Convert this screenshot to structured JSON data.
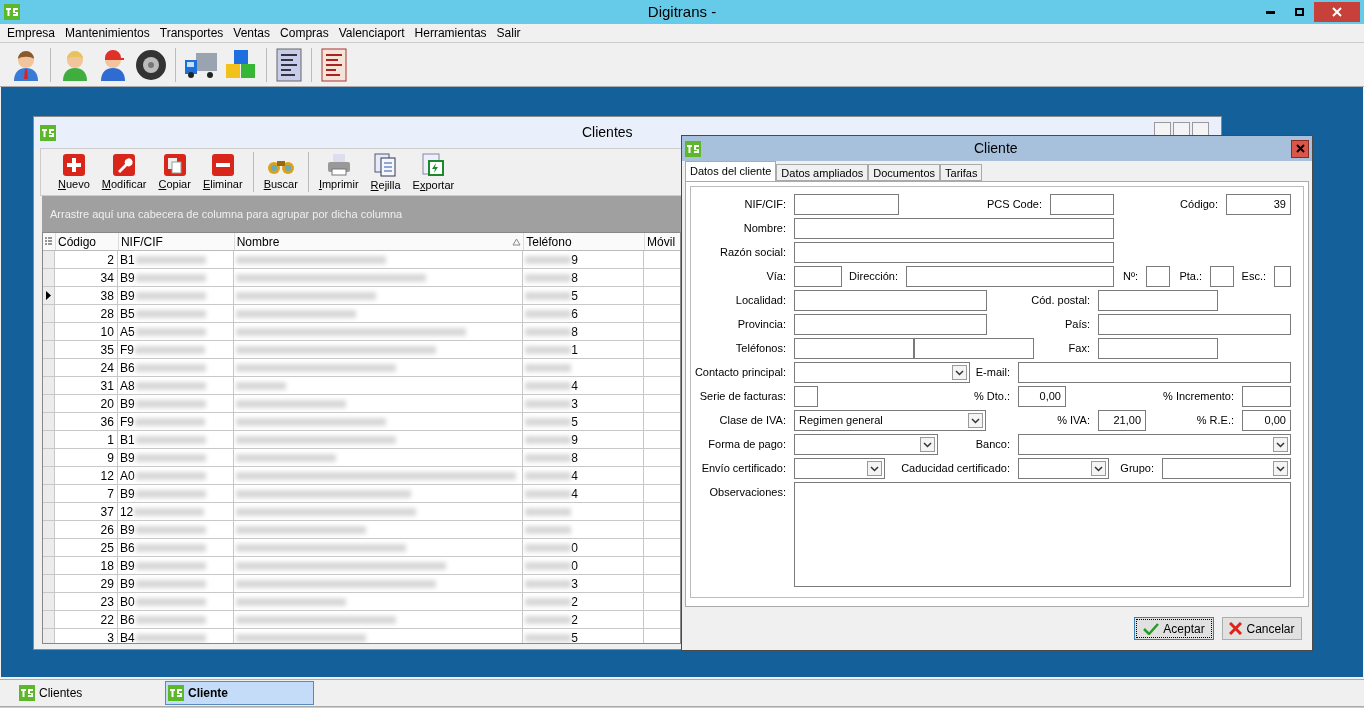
{
  "window": {
    "title": "Digitrans -"
  },
  "menu": [
    "Empresa",
    "Mantenimientos",
    "Transportes",
    "Ventas",
    "Compras",
    "Valenciaport",
    "Herramientas",
    "Salir"
  ],
  "clientes_window": {
    "title": "Clientes",
    "toolbar": [
      {
        "label": "Nuevo"
      },
      {
        "label": "Modificar"
      },
      {
        "label": "Copiar"
      },
      {
        "label": "Eliminar"
      },
      {
        "label": "Buscar"
      },
      {
        "label": "Imprimir"
      },
      {
        "label": "Rejilla"
      },
      {
        "label": "Exportar"
      }
    ],
    "group_hint": "Arrastre aquí una cabecera de columna para agrupar por dicha columna",
    "columns": [
      {
        "label": "Código",
        "sorted": false
      },
      {
        "label": "NIF/CIF",
        "sorted": false
      },
      {
        "label": "Nombre",
        "sorted": true
      },
      {
        "label": "Teléfono",
        "sorted": false
      },
      {
        "label": "Móvil",
        "sorted": false
      }
    ],
    "rows": [
      {
        "codigo": "2",
        "nif": "B1",
        "telefono": "9",
        "selected": false
      },
      {
        "codigo": "34",
        "nif": "B9",
        "telefono": "8",
        "selected": false
      },
      {
        "codigo": "38",
        "nif": "B9",
        "telefono": "5",
        "selected": true
      },
      {
        "codigo": "28",
        "nif": "B5",
        "telefono": "6",
        "selected": false
      },
      {
        "codigo": "10",
        "nif": "A5",
        "telefono": "8",
        "selected": false
      },
      {
        "codigo": "35",
        "nif": "F9",
        "telefono": "1",
        "selected": false
      },
      {
        "codigo": "24",
        "nif": "B6",
        "selected": false
      },
      {
        "codigo": "31",
        "nif": "A8",
        "telefono": "4",
        "selected": false
      },
      {
        "codigo": "20",
        "nif": "B9",
        "telefono": "3",
        "selected": false
      },
      {
        "codigo": "36",
        "nif": "F9",
        "telefono": "5",
        "selected": false
      },
      {
        "codigo": "1",
        "nif": "B1",
        "telefono": "9",
        "selected": false
      },
      {
        "codigo": "9",
        "nif": "B9",
        "telefono": "8",
        "selected": false
      },
      {
        "codigo": "12",
        "nif": "A0",
        "telefono": "4",
        "selected": false
      },
      {
        "codigo": "7",
        "nif": "B9",
        "telefono": "4",
        "selected": false
      },
      {
        "codigo": "37",
        "nif": "12",
        "selected": false
      },
      {
        "codigo": "26",
        "nif": "B9",
        "selected": false
      },
      {
        "codigo": "25",
        "nif": "B6",
        "telefono": "0",
        "selected": false
      },
      {
        "codigo": "18",
        "nif": "B9",
        "telefono": "0",
        "selected": false
      },
      {
        "codigo": "29",
        "nif": "B9",
        "telefono": "3",
        "selected": false
      },
      {
        "codigo": "23",
        "nif": "B0",
        "telefono": "2",
        "selected": false
      },
      {
        "codigo": "22",
        "nif": "B6",
        "telefono": "2",
        "selected": false
      },
      {
        "codigo": "3",
        "nif": "B4",
        "telefono": "5",
        "selected": false
      }
    ]
  },
  "dialog": {
    "title": "Cliente",
    "tabs": [
      {
        "label": "Datos del cliente",
        "selected": true
      },
      {
        "label": "Datos ampliados",
        "selected": false
      },
      {
        "label": "Documentos",
        "selected": false
      },
      {
        "label": "Tarifas",
        "selected": false
      }
    ],
    "rows": [
      [
        {
          "label": "NIF/CIF:",
          "kind": "text"
        },
        {
          "label": "PCS Code:",
          "kind": "text"
        },
        {
          "label": "Código:",
          "kind": "text",
          "value": "39"
        }
      ],
      [
        {
          "label": "Nombre:",
          "kind": "text"
        }
      ],
      [
        {
          "label": "Razón social:",
          "kind": "text"
        }
      ],
      [
        {
          "label": "Vía:",
          "kind": "text"
        },
        {
          "label": "Dirección:",
          "kind": "text"
        },
        {
          "label": "Nº:",
          "kind": "text"
        },
        {
          "label": "Pta.:",
          "kind": "text"
        },
        {
          "label": "Esc.:",
          "kind": "text"
        }
      ],
      [
        {
          "label": "Localidad:",
          "kind": "text"
        },
        {
          "label": "Cód. postal:",
          "kind": "text"
        }
      ],
      [
        {
          "label": "Provincia:",
          "kind": "text"
        },
        {
          "label": "País:",
          "kind": "text"
        }
      ],
      [
        {
          "label": "Teléfonos:",
          "kind": "pair"
        },
        {
          "label": "Fax:",
          "kind": "text"
        }
      ],
      [
        {
          "label": "Contacto principal:",
          "kind": "combo"
        },
        {
          "label": "E-mail:",
          "kind": "text"
        }
      ],
      [
        {
          "label": "Serie de facturas:",
          "kind": "text"
        },
        {
          "label": "% Dto.:",
          "kind": "text",
          "value": "0,00"
        },
        {
          "label": "% Incremento:",
          "kind": "text"
        }
      ],
      [
        {
          "label": "Clase de IVA:",
          "kind": "combo",
          "value": "Regimen general"
        },
        {
          "label": "% IVA:",
          "kind": "text",
          "value": "21,00"
        },
        {
          "label": "% R.E.:",
          "kind": "text",
          "value": "0,00"
        }
      ],
      [
        {
          "label": "Forma de pago:",
          "kind": "combo"
        },
        {
          "label": "Banco:",
          "kind": "combo"
        }
      ],
      [
        {
          "label": "Envío certificado:",
          "kind": "combo"
        },
        {
          "label": "Caducidad certificado:",
          "kind": "combo"
        },
        {
          "label": "Grupo:",
          "kind": "combo"
        }
      ],
      [
        {
          "label": "Observaciones:",
          "kind": "memo"
        }
      ]
    ],
    "buttons": [
      {
        "label": "Aceptar",
        "kind": "ok",
        "focused": true
      },
      {
        "label": "Cancelar",
        "kind": "cancel",
        "focused": false
      }
    ]
  },
  "taskbar": [
    {
      "label": "Clientes",
      "selected": false
    },
    {
      "label": "Cliente",
      "selected": true
    }
  ]
}
